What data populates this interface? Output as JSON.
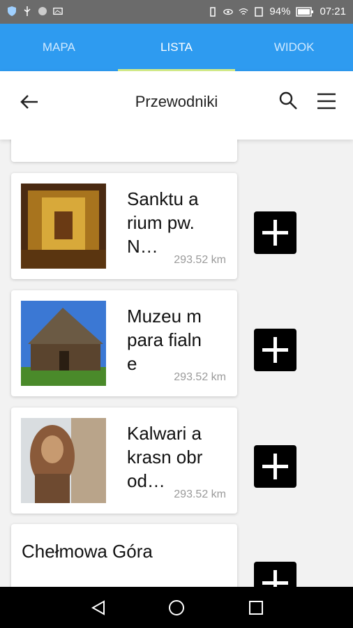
{
  "status": {
    "battery": "94%",
    "time": "07:21"
  },
  "tabs": [
    {
      "label": "MAPA"
    },
    {
      "label": "LISTA"
    },
    {
      "label": "WIDOK"
    }
  ],
  "toolbar": {
    "title": "Przewodniki"
  },
  "items": [
    {
      "name": "Sanktu arium pw. N…",
      "distance": "293.52 km"
    },
    {
      "name": "Muzeu m para fialne",
      "distance": "293.52 km"
    },
    {
      "name": "Kalwari a krasn obrod…",
      "distance": "293.52 km"
    },
    {
      "name": "Chełmowa Góra"
    }
  ],
  "colors": {
    "tabbar": "#2e9bf0",
    "tab_indicator": "#d6ee8a",
    "statusbar": "#6b6b6b"
  }
}
